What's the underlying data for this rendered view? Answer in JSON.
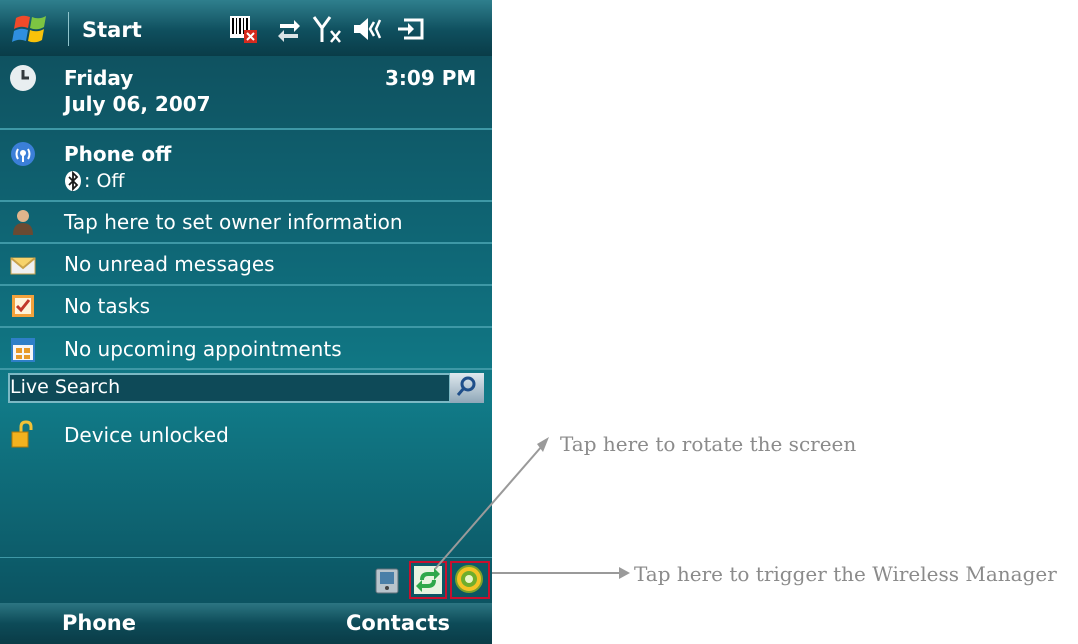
{
  "titlebar": {
    "start_label": "Start",
    "status_icons": [
      "sim-missing-icon",
      "sync-arrows-icon",
      "signal-off-icon",
      "volume-icon",
      "battery-charging-icon"
    ]
  },
  "datetime": {
    "day": "Friday",
    "date": "July 06, 2007",
    "time": "3:09 PM"
  },
  "phone": {
    "status": "Phone off",
    "bluetooth": ": Off"
  },
  "owner": {
    "label": "Tap here to set owner information"
  },
  "messages": {
    "label": "No unread messages"
  },
  "tasks": {
    "label": "No tasks"
  },
  "appointments": {
    "label": "No upcoming appointments"
  },
  "search": {
    "label": "Live Search"
  },
  "lock": {
    "label": "Device unlocked"
  },
  "tray": {
    "icons": [
      "device-icon",
      "rotate-screen-icon",
      "wireless-manager-icon"
    ]
  },
  "softkeys": {
    "left": "Phone",
    "right": "Contacts"
  },
  "annotations": {
    "rotate": "Tap here to rotate the screen",
    "wireless": "Tap here to trigger the Wireless Manager"
  },
  "colors": {
    "highlight_box": "#c8102e",
    "annotation_text": "#8b8b8b",
    "screen_bg": "#0f6877"
  }
}
